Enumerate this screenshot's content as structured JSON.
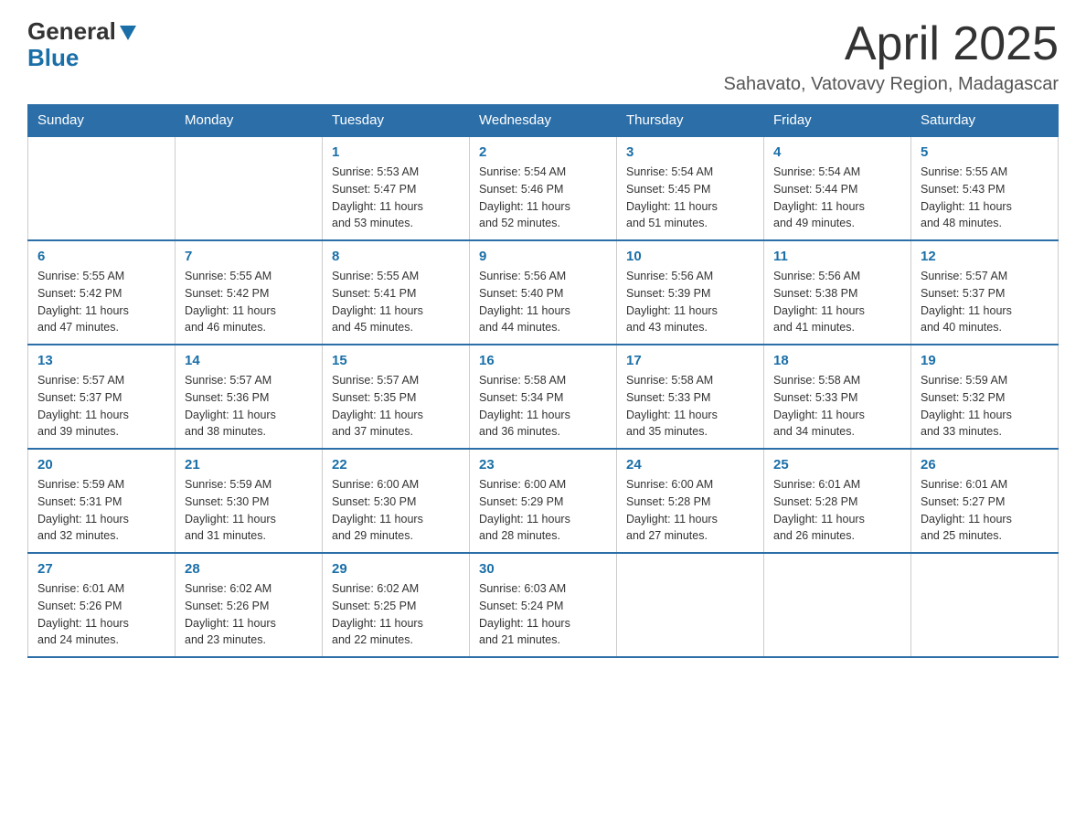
{
  "header": {
    "logo_general": "General",
    "logo_blue": "Blue",
    "month_year": "April 2025",
    "location": "Sahavato, Vatovavy Region, Madagascar"
  },
  "calendar": {
    "weekdays": [
      "Sunday",
      "Monday",
      "Tuesday",
      "Wednesday",
      "Thursday",
      "Friday",
      "Saturday"
    ],
    "weeks": [
      [
        {
          "day": "",
          "info": ""
        },
        {
          "day": "",
          "info": ""
        },
        {
          "day": "1",
          "info": "Sunrise: 5:53 AM\nSunset: 5:47 PM\nDaylight: 11 hours\nand 53 minutes."
        },
        {
          "day": "2",
          "info": "Sunrise: 5:54 AM\nSunset: 5:46 PM\nDaylight: 11 hours\nand 52 minutes."
        },
        {
          "day": "3",
          "info": "Sunrise: 5:54 AM\nSunset: 5:45 PM\nDaylight: 11 hours\nand 51 minutes."
        },
        {
          "day": "4",
          "info": "Sunrise: 5:54 AM\nSunset: 5:44 PM\nDaylight: 11 hours\nand 49 minutes."
        },
        {
          "day": "5",
          "info": "Sunrise: 5:55 AM\nSunset: 5:43 PM\nDaylight: 11 hours\nand 48 minutes."
        }
      ],
      [
        {
          "day": "6",
          "info": "Sunrise: 5:55 AM\nSunset: 5:42 PM\nDaylight: 11 hours\nand 47 minutes."
        },
        {
          "day": "7",
          "info": "Sunrise: 5:55 AM\nSunset: 5:42 PM\nDaylight: 11 hours\nand 46 minutes."
        },
        {
          "day": "8",
          "info": "Sunrise: 5:55 AM\nSunset: 5:41 PM\nDaylight: 11 hours\nand 45 minutes."
        },
        {
          "day": "9",
          "info": "Sunrise: 5:56 AM\nSunset: 5:40 PM\nDaylight: 11 hours\nand 44 minutes."
        },
        {
          "day": "10",
          "info": "Sunrise: 5:56 AM\nSunset: 5:39 PM\nDaylight: 11 hours\nand 43 minutes."
        },
        {
          "day": "11",
          "info": "Sunrise: 5:56 AM\nSunset: 5:38 PM\nDaylight: 11 hours\nand 41 minutes."
        },
        {
          "day": "12",
          "info": "Sunrise: 5:57 AM\nSunset: 5:37 PM\nDaylight: 11 hours\nand 40 minutes."
        }
      ],
      [
        {
          "day": "13",
          "info": "Sunrise: 5:57 AM\nSunset: 5:37 PM\nDaylight: 11 hours\nand 39 minutes."
        },
        {
          "day": "14",
          "info": "Sunrise: 5:57 AM\nSunset: 5:36 PM\nDaylight: 11 hours\nand 38 minutes."
        },
        {
          "day": "15",
          "info": "Sunrise: 5:57 AM\nSunset: 5:35 PM\nDaylight: 11 hours\nand 37 minutes."
        },
        {
          "day": "16",
          "info": "Sunrise: 5:58 AM\nSunset: 5:34 PM\nDaylight: 11 hours\nand 36 minutes."
        },
        {
          "day": "17",
          "info": "Sunrise: 5:58 AM\nSunset: 5:33 PM\nDaylight: 11 hours\nand 35 minutes."
        },
        {
          "day": "18",
          "info": "Sunrise: 5:58 AM\nSunset: 5:33 PM\nDaylight: 11 hours\nand 34 minutes."
        },
        {
          "day": "19",
          "info": "Sunrise: 5:59 AM\nSunset: 5:32 PM\nDaylight: 11 hours\nand 33 minutes."
        }
      ],
      [
        {
          "day": "20",
          "info": "Sunrise: 5:59 AM\nSunset: 5:31 PM\nDaylight: 11 hours\nand 32 minutes."
        },
        {
          "day": "21",
          "info": "Sunrise: 5:59 AM\nSunset: 5:30 PM\nDaylight: 11 hours\nand 31 minutes."
        },
        {
          "day": "22",
          "info": "Sunrise: 6:00 AM\nSunset: 5:30 PM\nDaylight: 11 hours\nand 29 minutes."
        },
        {
          "day": "23",
          "info": "Sunrise: 6:00 AM\nSunset: 5:29 PM\nDaylight: 11 hours\nand 28 minutes."
        },
        {
          "day": "24",
          "info": "Sunrise: 6:00 AM\nSunset: 5:28 PM\nDaylight: 11 hours\nand 27 minutes."
        },
        {
          "day": "25",
          "info": "Sunrise: 6:01 AM\nSunset: 5:28 PM\nDaylight: 11 hours\nand 26 minutes."
        },
        {
          "day": "26",
          "info": "Sunrise: 6:01 AM\nSunset: 5:27 PM\nDaylight: 11 hours\nand 25 minutes."
        }
      ],
      [
        {
          "day": "27",
          "info": "Sunrise: 6:01 AM\nSunset: 5:26 PM\nDaylight: 11 hours\nand 24 minutes."
        },
        {
          "day": "28",
          "info": "Sunrise: 6:02 AM\nSunset: 5:26 PM\nDaylight: 11 hours\nand 23 minutes."
        },
        {
          "day": "29",
          "info": "Sunrise: 6:02 AM\nSunset: 5:25 PM\nDaylight: 11 hours\nand 22 minutes."
        },
        {
          "day": "30",
          "info": "Sunrise: 6:03 AM\nSunset: 5:24 PM\nDaylight: 11 hours\nand 21 minutes."
        },
        {
          "day": "",
          "info": ""
        },
        {
          "day": "",
          "info": ""
        },
        {
          "day": "",
          "info": ""
        }
      ]
    ]
  }
}
